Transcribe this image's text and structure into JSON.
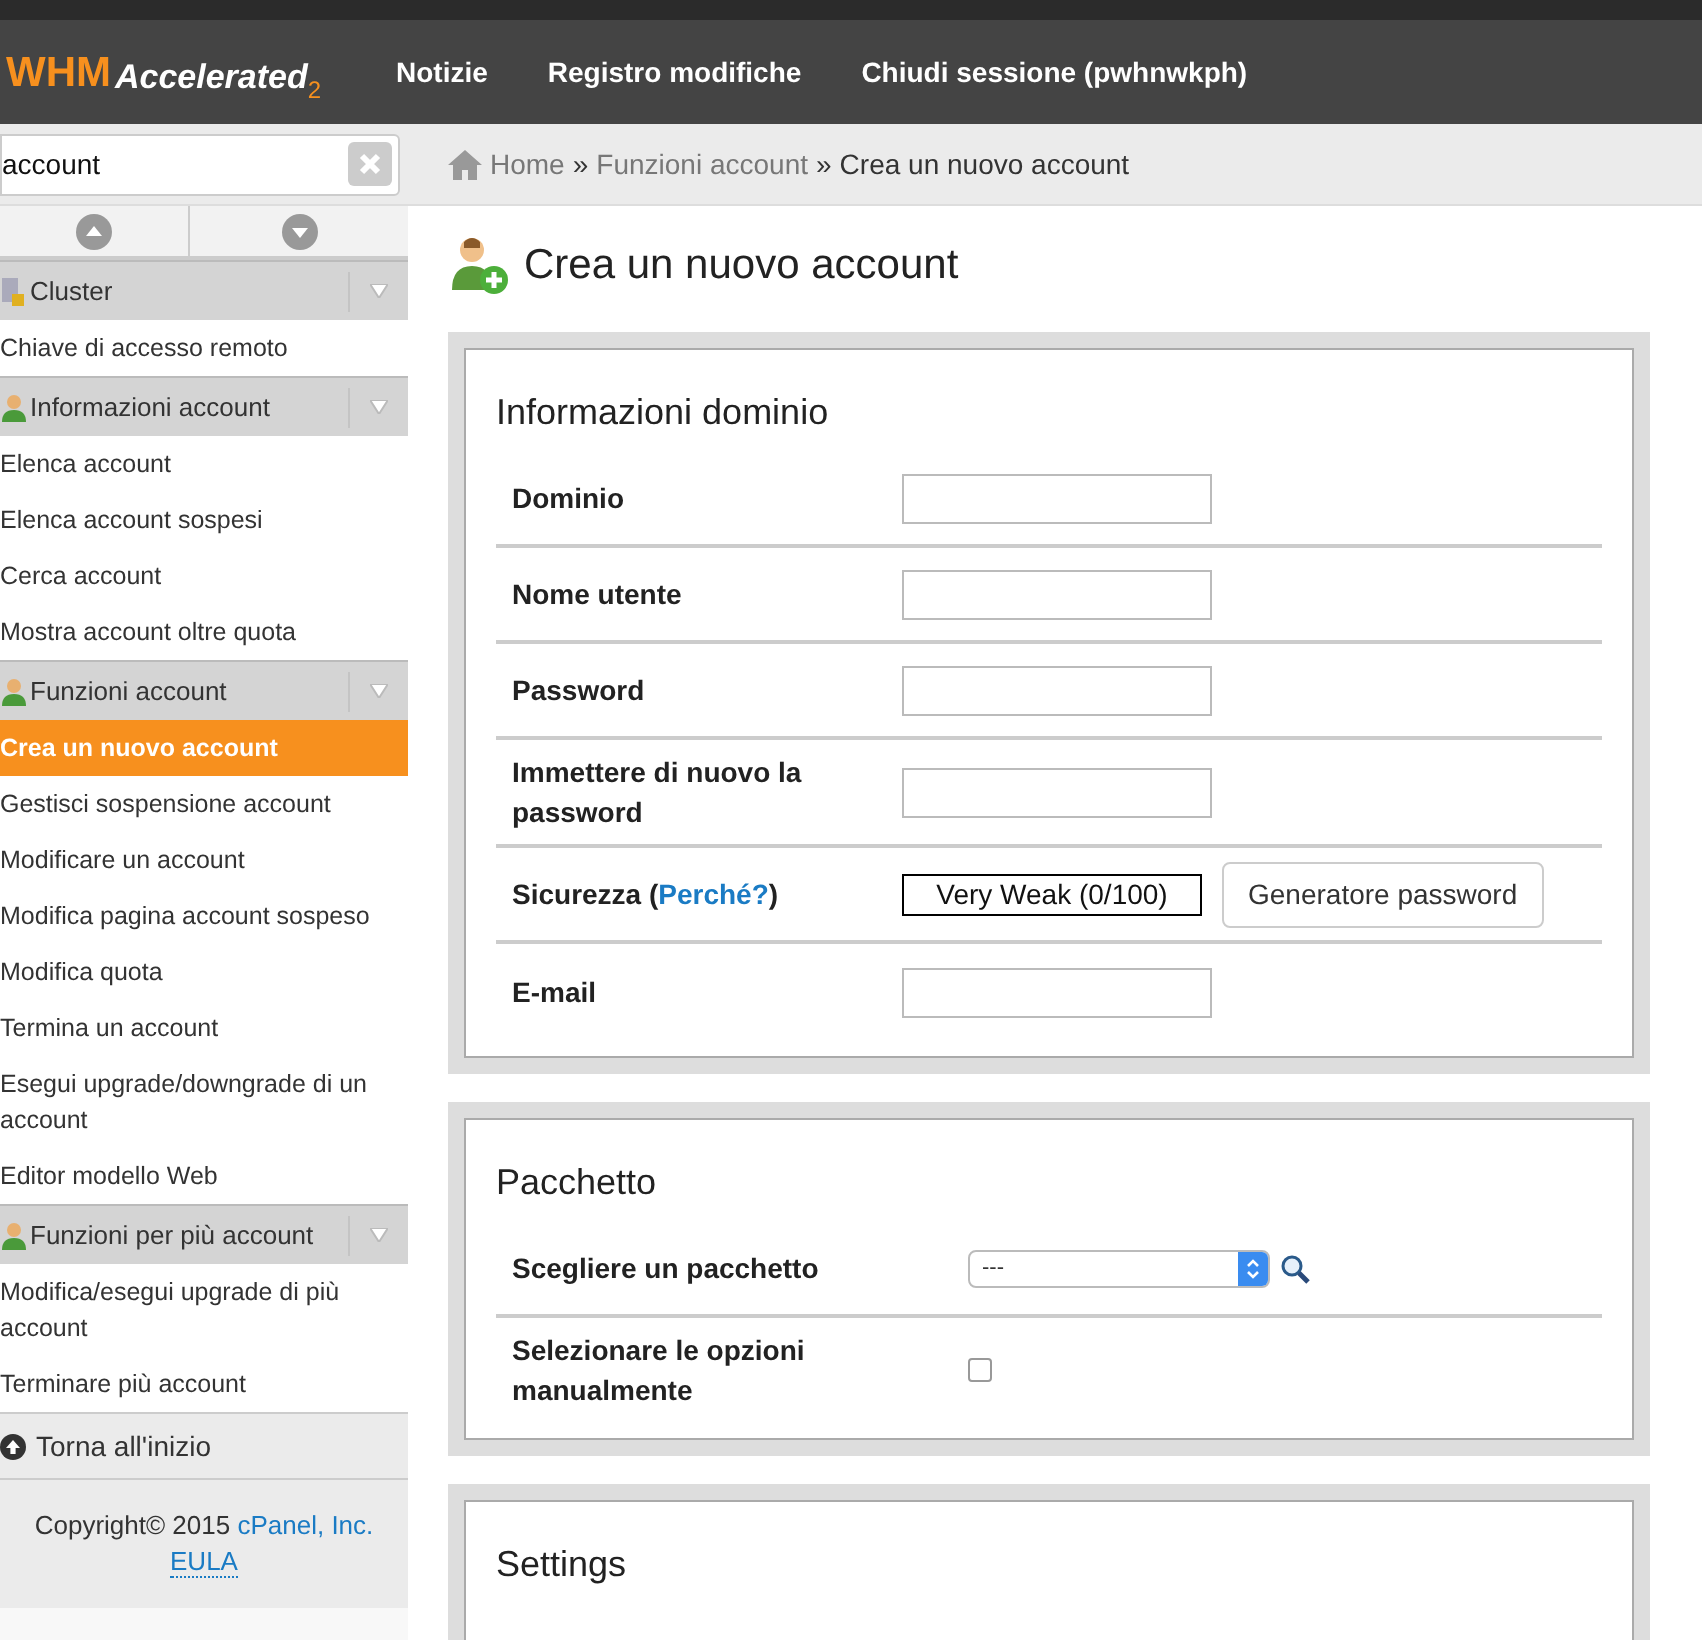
{
  "header": {
    "logo": {
      "main": "WHM",
      "script": "Accelerated",
      "version": "2"
    },
    "nav": [
      "Notizie",
      "Registro modifiche",
      "Chiudi sessione (pwhnwkph)"
    ]
  },
  "search": {
    "value": "account"
  },
  "breadcrumb": [
    {
      "label": "Home",
      "link": true
    },
    {
      "sep": "»",
      "label": "Funzioni account",
      "link": true
    },
    {
      "sep": "»",
      "label": "Crea un nuovo account",
      "link": false
    }
  ],
  "sidebar": {
    "groups": [
      {
        "title": "Cluster",
        "items": [
          {
            "label": "Chiave di accesso remoto",
            "selected": false
          }
        ]
      },
      {
        "title": "Informazioni account",
        "items": [
          {
            "label": "Elenca account",
            "selected": false
          },
          {
            "label": "Elenca account sospesi",
            "selected": false
          },
          {
            "label": "Cerca account",
            "selected": false
          },
          {
            "label": "Mostra account oltre quota",
            "selected": false
          }
        ]
      },
      {
        "title": "Funzioni account",
        "items": [
          {
            "label": "Crea un nuovo account",
            "selected": true
          },
          {
            "label": "Gestisci sospensione account",
            "selected": false
          },
          {
            "label": "Modificare un account",
            "selected": false
          },
          {
            "label": "Modifica pagina account sospeso",
            "selected": false
          },
          {
            "label": "Modifica quota",
            "selected": false
          },
          {
            "label": "Termina un account",
            "selected": false
          },
          {
            "label": "Esegui upgrade/downgrade di un account",
            "selected": false
          },
          {
            "label": "Editor modello Web",
            "selected": false
          }
        ]
      },
      {
        "title": "Funzioni per più account",
        "items": [
          {
            "label": "Modifica/esegui upgrade di più account",
            "selected": false
          },
          {
            "label": "Terminare più account",
            "selected": false
          }
        ]
      }
    ],
    "back_to_top": "Torna all'inizio",
    "copyright": "Copyright© 2015",
    "company": "cPanel, Inc.",
    "eula": "EULA"
  },
  "page_title": "Crea un nuovo account",
  "panels": [
    {
      "title": "Informazioni dominio",
      "rows": [
        {
          "kind": "text",
          "label": "Dominio"
        },
        {
          "kind": "text",
          "label": "Nome utente"
        },
        {
          "kind": "text",
          "label": "Password"
        },
        {
          "kind": "text",
          "label": "Immettere di nuovo la password"
        },
        {
          "kind": "strength",
          "label": "Sicurezza (",
          "link": "Perché?",
          "label_end": ")",
          "meter": "Very Weak (0/100)",
          "button": "Generatore password"
        },
        {
          "kind": "text",
          "label": "E-mail"
        }
      ]
    },
    {
      "title": "Pacchetto",
      "rows": [
        {
          "kind": "select",
          "label": "Scegliere un pacchetto",
          "value": "---"
        },
        {
          "kind": "checkbox",
          "label": "Selezionare le opzioni manualmente",
          "checked": false
        }
      ]
    },
    {
      "title": "Settings"
    }
  ]
}
